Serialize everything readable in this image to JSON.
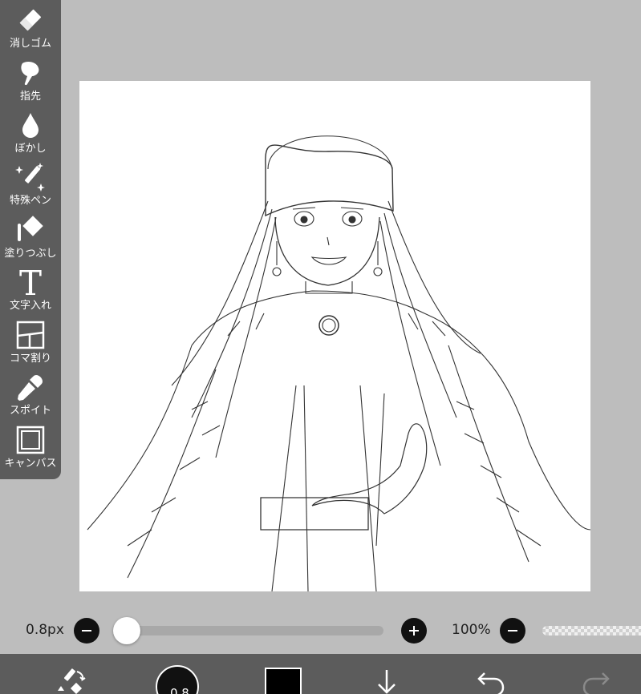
{
  "tools": [
    {
      "label": "消しゴム",
      "icon": "eraser-icon"
    },
    {
      "label": "指先",
      "icon": "finger-smudge-icon"
    },
    {
      "label": "ぼかし",
      "icon": "blur-drop-icon"
    },
    {
      "label": "特殊ペン",
      "icon": "special-pen-icon"
    },
    {
      "label": "塗りつぶし",
      "icon": "fill-bucket-icon"
    },
    {
      "label": "文字入れ",
      "icon": "text-icon"
    },
    {
      "label": "コマ割り",
      "icon": "frame-divider-icon"
    },
    {
      "label": "スポイト",
      "icon": "eyedropper-icon"
    },
    {
      "label": "キャンバス",
      "icon": "canvas-icon"
    }
  ],
  "brush": {
    "size_label": "0.8px",
    "size_slider_fraction": 0.0,
    "preview_text": "0.8"
  },
  "zoom": {
    "label": "100%"
  },
  "colors": {
    "sidebar_bg": "#5c5c5c",
    "workspace_bg": "#bdbdbd",
    "current_color": "#000000",
    "canvas_bg": "#ffffff"
  },
  "bottom_toolbar": {
    "icons": [
      "transform-icon",
      "brush-preview",
      "color-swatch",
      "layer-down-arrow-icon",
      "undo-icon",
      "redo-icon"
    ]
  }
}
